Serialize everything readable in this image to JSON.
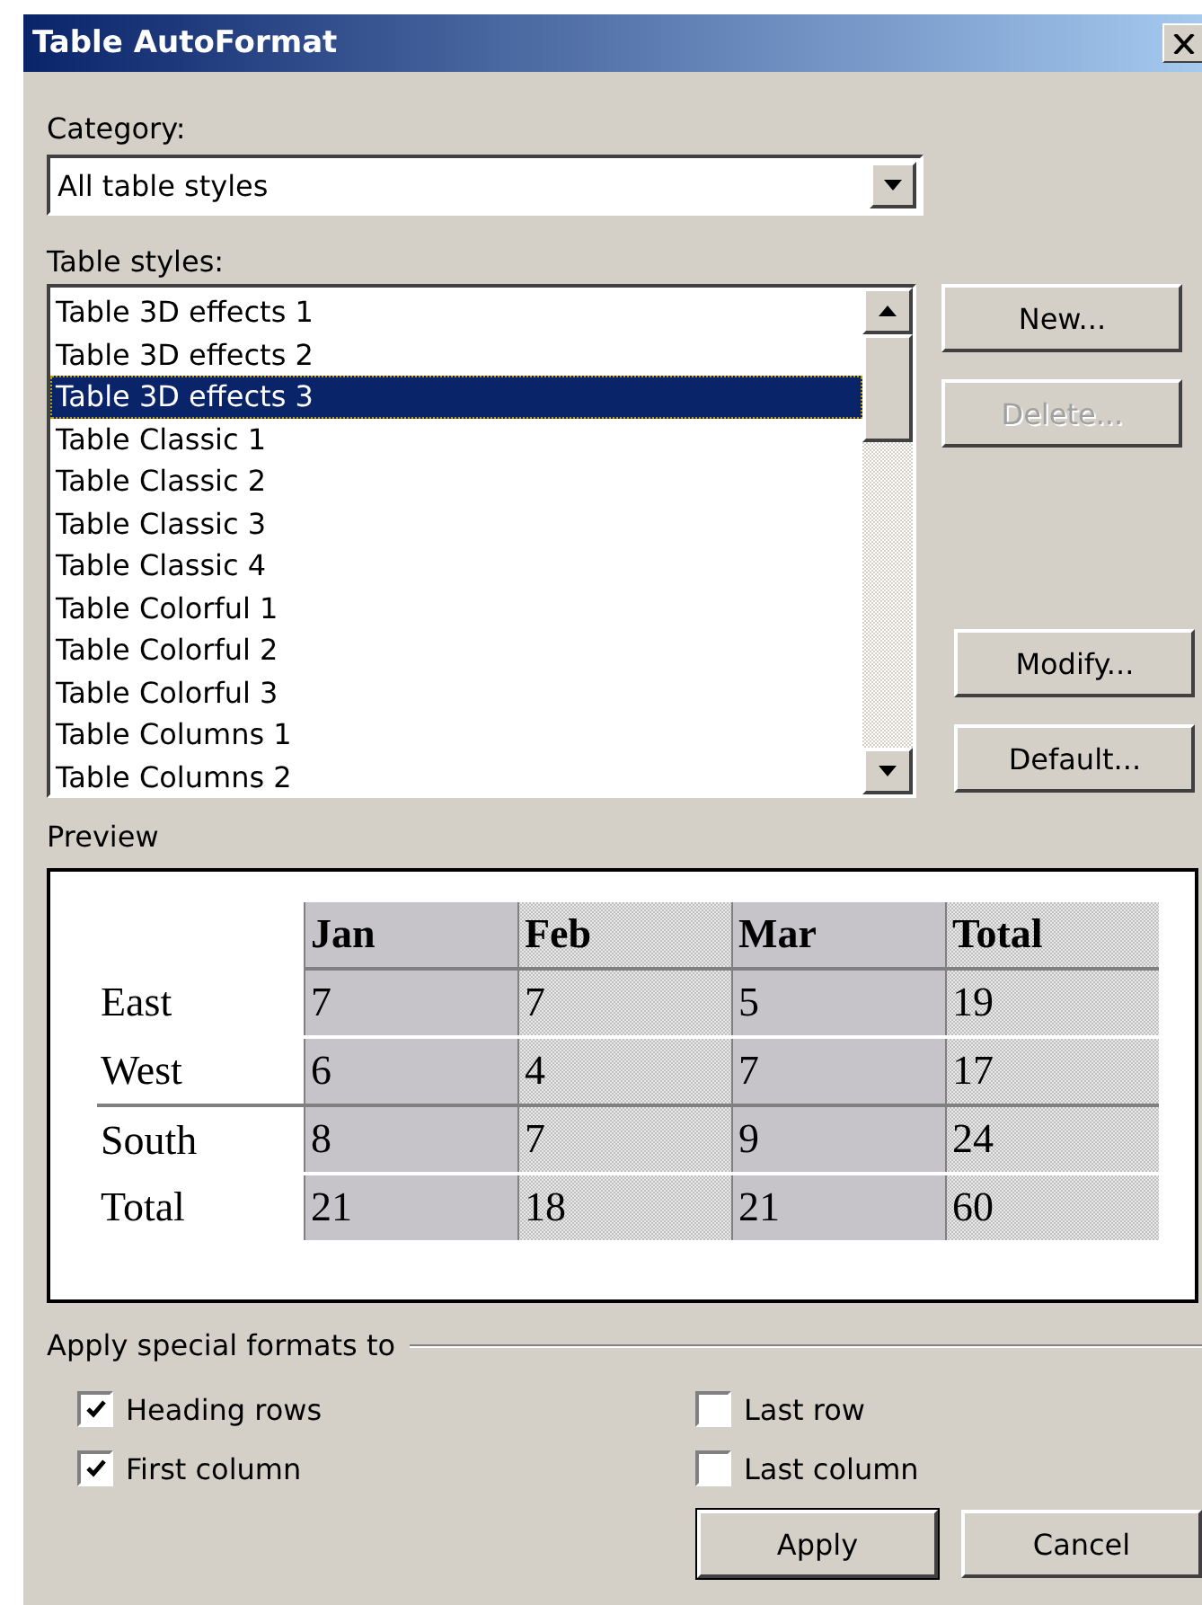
{
  "window": {
    "title": "Table AutoFormat"
  },
  "category": {
    "label": "Category:",
    "value": "All table styles"
  },
  "table_styles": {
    "label": "Table styles:",
    "items": [
      {
        "label": "Table 3D effects 1",
        "selected": false
      },
      {
        "label": "Table 3D effects 2",
        "selected": false
      },
      {
        "label": "Table 3D effects 3",
        "selected": true
      },
      {
        "label": "Table Classic 1",
        "selected": false
      },
      {
        "label": "Table Classic 2",
        "selected": false
      },
      {
        "label": "Table Classic 3",
        "selected": false
      },
      {
        "label": "Table Classic 4",
        "selected": false
      },
      {
        "label": "Table Colorful 1",
        "selected": false
      },
      {
        "label": "Table Colorful 2",
        "selected": false
      },
      {
        "label": "Table Colorful 3",
        "selected": false
      },
      {
        "label": "Table Columns 1",
        "selected": false
      },
      {
        "label": "Table Columns 2",
        "selected": false
      }
    ]
  },
  "side_buttons": [
    {
      "label": "New...",
      "disabled": false
    },
    {
      "label": "Delete...",
      "disabled": true
    },
    {
      "label": "Modify...",
      "disabled": false
    },
    {
      "label": "Default...",
      "disabled": false
    }
  ],
  "preview": {
    "label": "Preview",
    "columns": [
      "Jan",
      "Feb",
      "Mar",
      "Total"
    ],
    "rows": [
      {
        "label": "East",
        "cells": [
          "7",
          "7",
          "5",
          "19"
        ]
      },
      {
        "label": "West",
        "cells": [
          "6",
          "4",
          "7",
          "17"
        ]
      },
      {
        "label": "South",
        "cells": [
          "8",
          "7",
          "9",
          "24"
        ]
      },
      {
        "label": "Total",
        "cells": [
          "21",
          "18",
          "21",
          "60"
        ]
      }
    ]
  },
  "special_formats": {
    "label": "Apply special formats to",
    "options": [
      {
        "label": "Heading rows",
        "checked": true
      },
      {
        "label": "Last row",
        "checked": false
      },
      {
        "label": "First column",
        "checked": true
      },
      {
        "label": "Last column",
        "checked": false
      }
    ]
  },
  "buttons": [
    {
      "label": "Apply",
      "default": true
    },
    {
      "label": "Cancel",
      "default": false
    }
  ]
}
